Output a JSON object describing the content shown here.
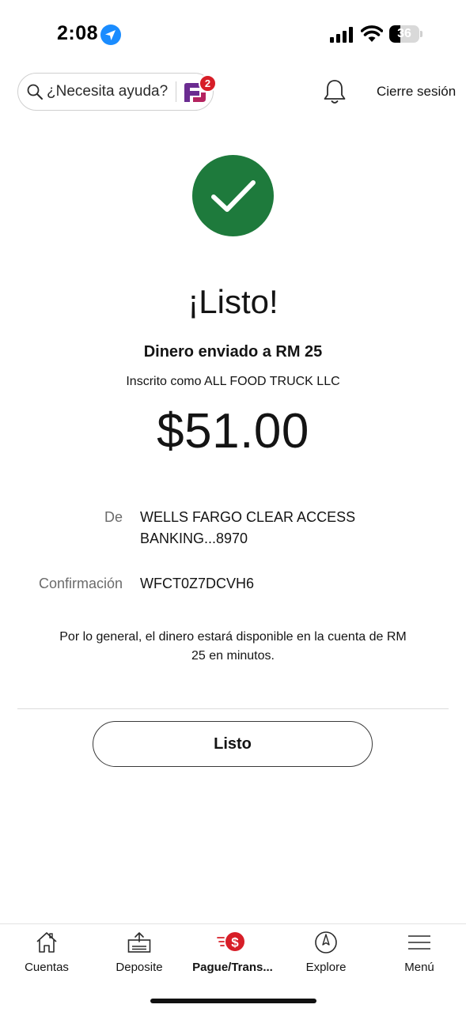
{
  "status_bar": {
    "time": "2:08",
    "battery": "36",
    "battery_level": 0.36
  },
  "header": {
    "search_placeholder": "¿Necesita ayuda?",
    "notification_badge": "2",
    "logout_label": "Cierre sesión"
  },
  "confirmation": {
    "headline": "¡Listo!",
    "sent_to": "Dinero enviado a RM 25",
    "registered_as": "Inscrito como ALL FOOD TRUCK LLC",
    "amount": "$51.00",
    "from_label": "De",
    "from_line1": "WELLS FARGO CLEAR ACCESS",
    "from_line2": "BANKING...8970",
    "confirmation_label": "Confirmación",
    "confirmation_code": "WFCT0Z7DCVH6",
    "note": "Por lo general, el dinero estará disponible en la cuenta de RM 25 en minutos.",
    "done_button": "Listo"
  },
  "bottom_nav": {
    "items": [
      {
        "label": "Cuentas",
        "icon": "home-icon"
      },
      {
        "label": "Deposite",
        "icon": "deposit-icon"
      },
      {
        "label": "Pague/Trans...",
        "icon": "pay-transfer-icon",
        "active": true
      },
      {
        "label": "Explore",
        "icon": "compass-icon"
      },
      {
        "label": "Menú",
        "icon": "menu-icon"
      }
    ]
  },
  "colors": {
    "success_green": "#1e7a3c",
    "badge_red": "#d71e28",
    "brand_purple": "#6b2c91",
    "text": "#141414",
    "muted": "#6b6b6b"
  }
}
